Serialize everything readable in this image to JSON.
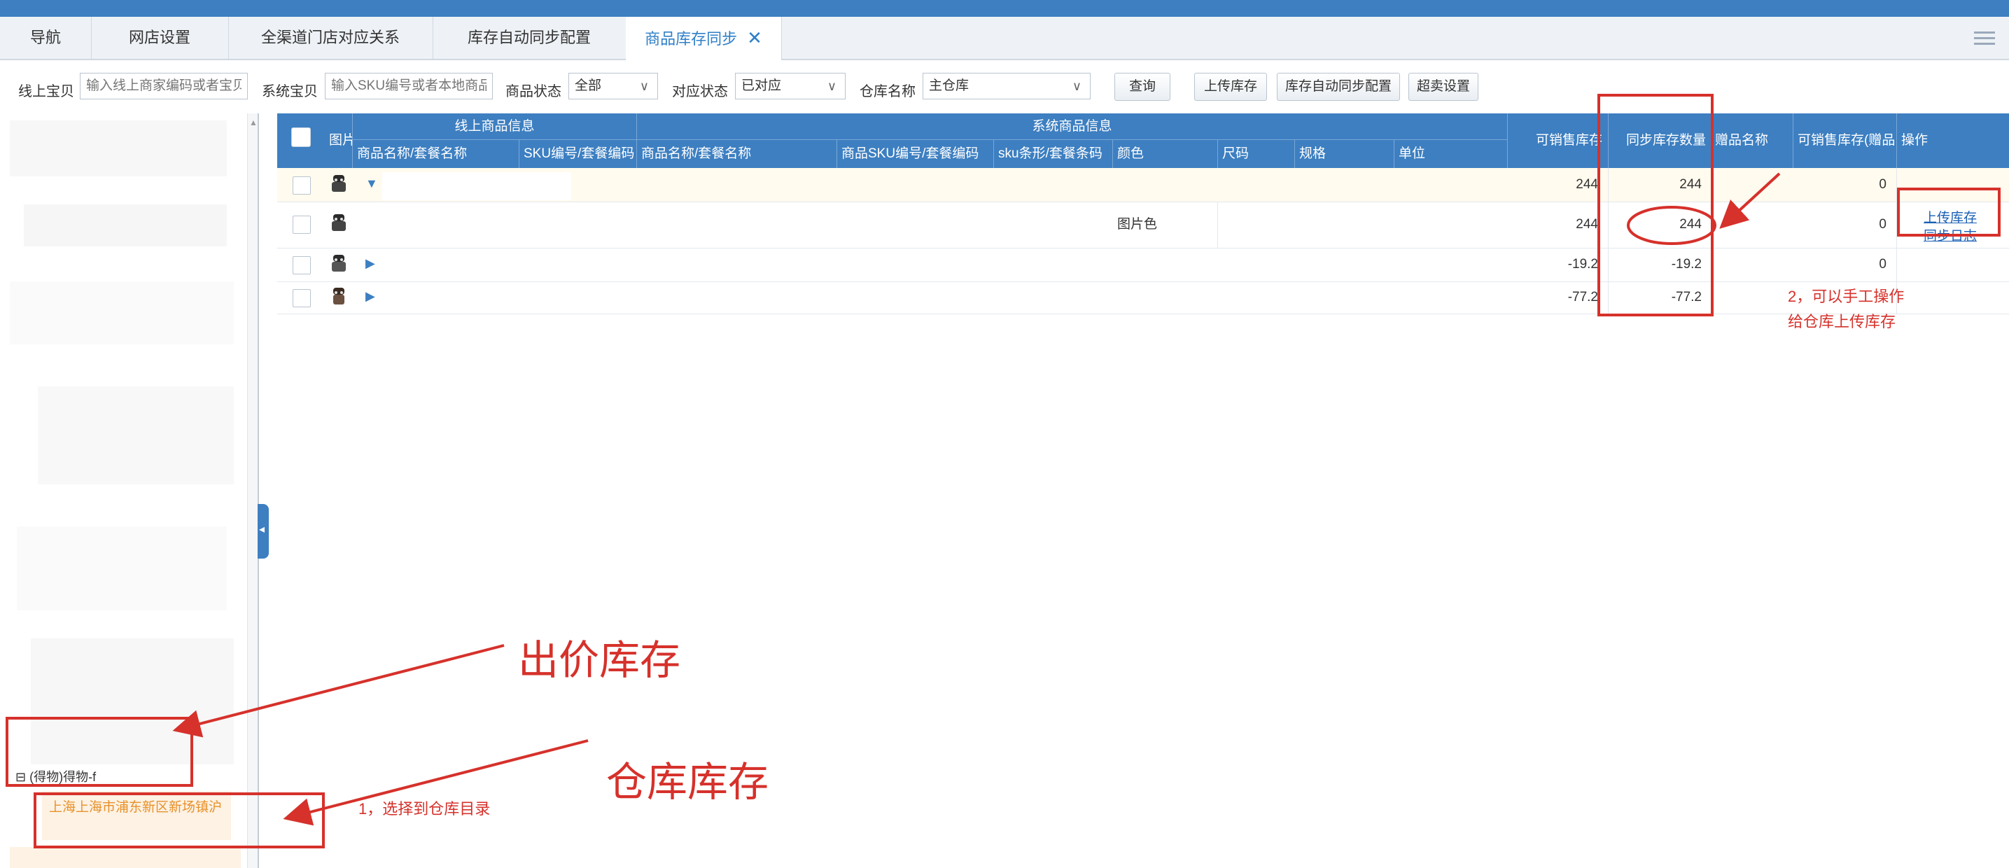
{
  "tabs": [
    {
      "label": "导航"
    },
    {
      "label": "网店设置"
    },
    {
      "label": "全渠道门店对应关系"
    },
    {
      "label": "库存自动同步配置"
    },
    {
      "label": "商品库存同步",
      "close": "✕"
    }
  ],
  "toolbar": {
    "online_label": "线上宝贝",
    "online_placeholder": "输入线上商家编码或者宝贝",
    "system_label": "系统宝贝",
    "system_placeholder": "输入SKU编号或者本地商品",
    "status_label": "商品状态",
    "status_value": "全部",
    "match_label": "对应状态",
    "match_value": "已对应",
    "warehouse_label": "仓库名称",
    "warehouse_value": "主仓库",
    "query_btn": "查询",
    "upload_btn": "上传库存",
    "auto_sync_btn": "库存自动同步配置",
    "oversell_btn": "超卖设置"
  },
  "grid": {
    "headers": {
      "image": "图片",
      "online_group": "线上商品信息",
      "online_name": "商品名称/套餐名称",
      "online_sku": "SKU编号/套餐编码",
      "system_group": "系统商品信息",
      "sys_name": "商品名称/套餐名称",
      "sys_sku": "商品SKU编号/套餐编码",
      "sys_sku_attr": "sku条形/套餐条码",
      "color": "颜色",
      "size": "尺码",
      "spec": "规格",
      "unit": "单位",
      "available": "可销售库存",
      "sync_qty": "同步库存数量",
      "gift_name": "赠品名称",
      "available_gift": "可销售库存(赠品",
      "ops": "操作"
    },
    "rows": [
      {
        "color": "",
        "available": "244",
        "sync": "244",
        "gift_avail": "0",
        "op1": "",
        "op2": ""
      },
      {
        "color": "图片色",
        "available": "244",
        "sync": "244",
        "gift_avail": "0",
        "op1": "上传库存",
        "op2": "同步日志"
      },
      {
        "color": "",
        "available": "-19.2",
        "sync": "-19.2",
        "gift_avail": "0",
        "op1": "",
        "op2": ""
      },
      {
        "color": "",
        "available": "-77.2",
        "sync": "-77.2",
        "gift_avail": "",
        "op1": "",
        "op2": ""
      }
    ]
  },
  "left_tree": {
    "node_label": "(得物)得物-f",
    "selected_label": "上海上海市浦东新区新场镇沪"
  },
  "annotations": {
    "bid_stock": "出价库存",
    "warehouse_stock": "仓库库存",
    "step1": "1，选择到仓库目录",
    "step2_line1": "2，可以手工操作",
    "step2_line2": "给仓库上传库存",
    "accent_color": "#d6312b"
  }
}
